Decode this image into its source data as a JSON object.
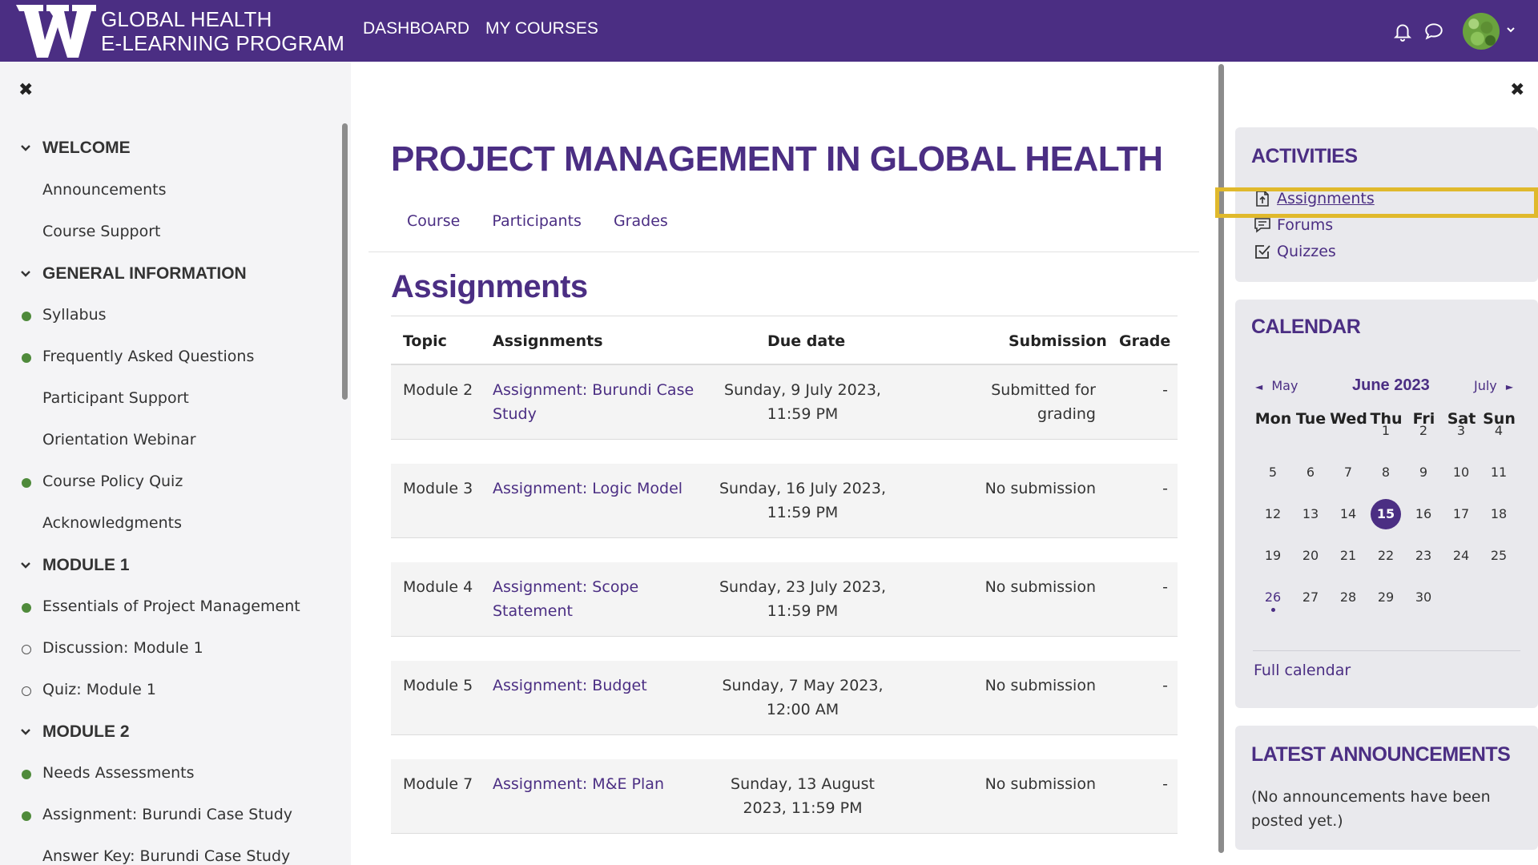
{
  "navbar": {
    "logo_line1": "GLOBAL HEALTH",
    "logo_line2": "E-LEARNING PROGRAM",
    "links": [
      "DASHBOARD",
      "MY COURSES"
    ]
  },
  "left_drawer": {
    "close_glyph": "✖",
    "sections": [
      {
        "title": "WELCOME",
        "items": [
          {
            "label": "Announcements",
            "status": "none"
          },
          {
            "label": "Course Support",
            "status": "none"
          }
        ]
      },
      {
        "title": "GENERAL INFORMATION",
        "items": [
          {
            "label": "Syllabus",
            "status": "complete"
          },
          {
            "label": "Frequently Asked Questions",
            "status": "complete"
          },
          {
            "label": "Participant Support",
            "status": "none"
          },
          {
            "label": "Orientation Webinar",
            "status": "none"
          },
          {
            "label": "Course Policy Quiz",
            "status": "complete"
          },
          {
            "label": "Acknowledgments",
            "status": "none"
          }
        ]
      },
      {
        "title": "MODULE 1",
        "items": [
          {
            "label": "Essentials of Project Management",
            "status": "complete"
          },
          {
            "label": "Discussion: Module 1",
            "status": "incomplete"
          },
          {
            "label": "Quiz: Module 1",
            "status": "incomplete"
          }
        ]
      },
      {
        "title": "MODULE 2",
        "items": [
          {
            "label": "Needs Assessments",
            "status": "complete"
          },
          {
            "label": "Assignment: Burundi Case Study",
            "status": "complete"
          },
          {
            "label": "Answer Key: Burundi Case Study",
            "status": "none"
          }
        ]
      }
    ]
  },
  "main": {
    "course_title": "PROJECT MANAGEMENT IN GLOBAL HEALTH",
    "secondary_nav": [
      "Course",
      "Participants",
      "Grades"
    ],
    "heading": "Assignments",
    "table": {
      "headers": {
        "topic": "Topic",
        "assignments": "Assignments",
        "due": "Due date",
        "submission": "Submission",
        "grade": "Grade"
      },
      "rows": [
        {
          "topic": "Module 2",
          "assignment": "Assignment: Burundi Case Study",
          "due": "Sunday, 9 July 2023, 11:59 PM",
          "submission": "Submitted for grading",
          "grade": "-"
        },
        {
          "topic": "Module 3",
          "assignment": "Assignment: Logic Model",
          "due": "Sunday, 16 July 2023, 11:59 PM",
          "submission": "No submission",
          "grade": "-"
        },
        {
          "topic": "Module 4",
          "assignment": "Assignment: Scope Statement",
          "due": "Sunday, 23 July 2023, 11:59 PM",
          "submission": "No submission",
          "grade": "-"
        },
        {
          "topic": "Module 5",
          "assignment": "Assignment: Budget",
          "due": "Sunday, 7 May 2023, 12:00 AM",
          "submission": "No submission",
          "grade": "-"
        },
        {
          "topic": "Module 7",
          "assignment": "Assignment: M&E Plan",
          "due": "Sunday, 13 August 2023, 11:59 PM",
          "submission": "No submission",
          "grade": "-"
        }
      ]
    }
  },
  "right_drawer": {
    "close_glyph": "✖",
    "activities": {
      "title": "ACTIVITIES",
      "items": [
        {
          "label": "Assignments",
          "icon": "assignment-icon"
        },
        {
          "label": "Forums",
          "icon": "forum-icon"
        },
        {
          "label": "Quizzes",
          "icon": "quiz-icon"
        }
      ]
    },
    "calendar": {
      "title": "CALENDAR",
      "prev_month": "May",
      "current_month": "June 2023",
      "next_month": "July",
      "prev_arrow": "◄",
      "next_arrow": "►",
      "weekdays": [
        "Mon",
        "Tue",
        "Wed",
        "Thu",
        "Fri",
        "Sat",
        "Sun"
      ],
      "first_weekday_index": 3,
      "days_in_month": 30,
      "today": 15,
      "event_days": [
        26
      ],
      "full_calendar_label": "Full calendar"
    },
    "announcements": {
      "title": "LATEST ANNOUNCEMENTS",
      "text": "(No announcements have been posted yet.)"
    }
  },
  "colors": {
    "brand_purple": "#4b2e83",
    "complete_green": "#4f8a3b",
    "highlight_gold": "#e0b92c"
  }
}
